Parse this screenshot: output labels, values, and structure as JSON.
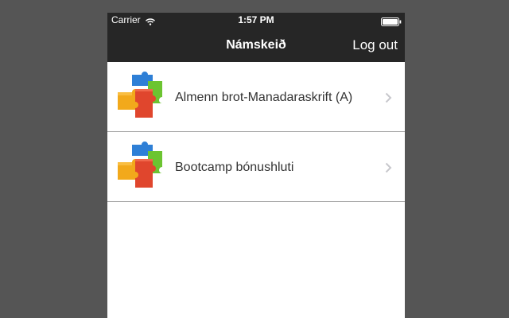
{
  "status_bar": {
    "carrier": "Carrier",
    "time": "1:57 PM",
    "icons": [
      "wifi-icon",
      "battery-icon"
    ]
  },
  "nav_bar": {
    "title": "Námskeið",
    "logout_label": "Log out"
  },
  "courses": [
    {
      "label": "Almenn brot-Manadaraskrift (A)",
      "icon": "puzzle-icon"
    },
    {
      "label": "Bootcamp bónushluti",
      "icon": "puzzle-icon"
    }
  ],
  "colors": {
    "background": "#555555",
    "nav_background": "#262626",
    "list_background": "#ffffff",
    "separator": "#a9a9a9",
    "chevron": "#c7c7cc",
    "puzzle": [
      "#2e7fd6",
      "#6cc431",
      "#f2a91b",
      "#e0462d"
    ]
  }
}
